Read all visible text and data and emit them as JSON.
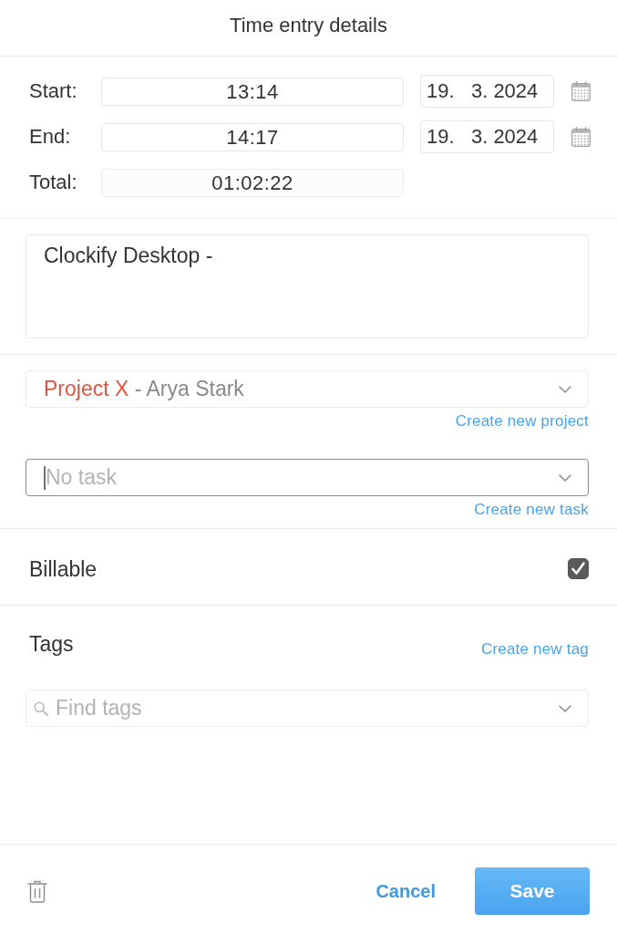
{
  "dialog": {
    "title": "Time entry details"
  },
  "time": [
    {
      "label": "Start:",
      "value": "13:14",
      "date": "19.   3. 2024"
    },
    {
      "label": "End:",
      "value": "14:17",
      "date": "19.   3. 2024"
    }
  ],
  "total": {
    "label": "Total:",
    "value": "01:02:22"
  },
  "description": {
    "value": "Clockify Desktop -"
  },
  "project": {
    "name": "Project X",
    "separator": "-",
    "client": "Arya Stark",
    "link": "Create new project"
  },
  "task": {
    "placeholder": "No task",
    "focused": true,
    "link": "Create new task"
  },
  "billable": {
    "label": "Billable",
    "checked": true
  },
  "tags": {
    "label": "Tags",
    "link": "Create new tag",
    "placeholder": "Find tags"
  },
  "footer": {
    "cancel": "Cancel",
    "save": "Save"
  }
}
